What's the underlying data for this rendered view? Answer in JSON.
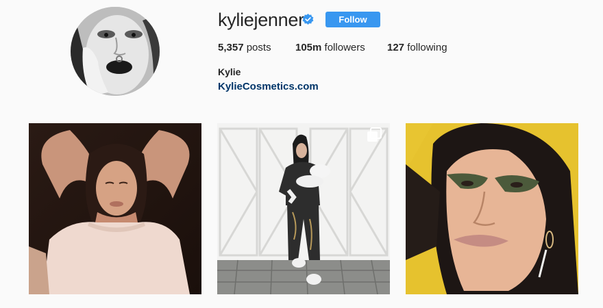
{
  "profile": {
    "username": "kyliejenner",
    "verified_icon": "verified-badge-icon",
    "follow_label": "Follow",
    "stats": {
      "posts_count": "5,357",
      "posts_label": "posts",
      "followers_count": "105m",
      "followers_label": "followers",
      "following_count": "127",
      "following_label": "following"
    },
    "full_name": "Kylie",
    "website": "KylieCosmetics.com"
  },
  "posts": [
    {
      "icon": null
    },
    {
      "icon": "multiple-photos-icon"
    },
    {
      "icon": null
    }
  ],
  "colors": {
    "follow_button": "#3897f0",
    "verified_badge": "#3897f0",
    "link": "#003569",
    "background": "#fafafa"
  }
}
